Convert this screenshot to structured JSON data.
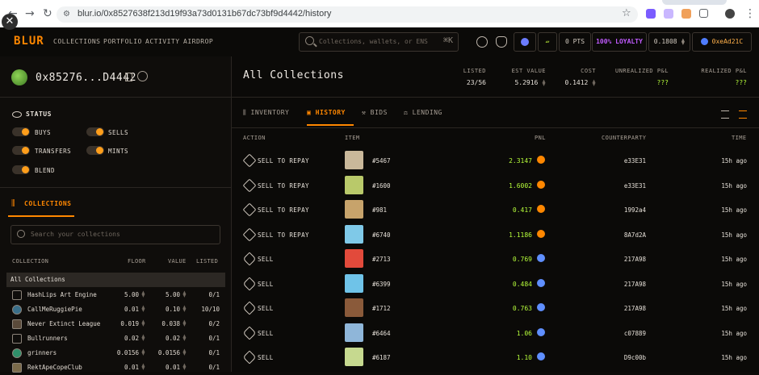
{
  "browser": {
    "url": "blur.io/0x8527638f213d19f93a73d0131b67dc73bf9d4442/history"
  },
  "app": {
    "logo": "BLUR",
    "nav": [
      "COLLECTIONS",
      "PORTFOLIO",
      "ACTIVITY",
      "AIRDROP"
    ],
    "search_placeholder": "Collections, wallets, or ENS",
    "search_shortcut": "⌘K",
    "points": "0 PTS",
    "loyalty": "100% LOYALTY",
    "balance": "0.1808",
    "account": "0xeAd21C",
    "colors": {
      "accent": "#ff8700",
      "positive": "#b8ff3b",
      "loyalty": "#b44bff"
    }
  },
  "sidebar": {
    "wallet": "0x85276...D4442",
    "status_title": "STATUS",
    "toggles": [
      {
        "label": "BUYS",
        "on": true
      },
      {
        "label": "SELLS",
        "on": true
      },
      {
        "label": "TRANSFERS",
        "on": true
      },
      {
        "label": "MINTS",
        "on": true
      },
      {
        "label": "BLEND",
        "on": true
      }
    ],
    "collections_tab": "COLLECTIONS",
    "collection_search_placeholder": "Search your collections",
    "headers": {
      "collection": "COLLECTION",
      "floor": "FLOOR",
      "value": "VALUE",
      "listed": "LISTED"
    },
    "all_label": "All Collections",
    "rows": [
      {
        "name": "HashLips Art Engine",
        "floor": "5.00",
        "value": "5.00",
        "listed": "0/1"
      },
      {
        "name": "CallMeRuggiePie",
        "floor": "0.01",
        "value": "0.10",
        "listed": "10/10"
      },
      {
        "name": "Never Extinct League",
        "floor": "0.019",
        "value": "0.038",
        "listed": "0/2"
      },
      {
        "name": "Bullrunners",
        "floor": "0.02",
        "value": "0.02",
        "listed": "0/1"
      },
      {
        "name": "grinners",
        "floor": "0.0156",
        "value": "0.0156",
        "listed": "0/1"
      },
      {
        "name": "RektApeCopeClub",
        "floor": "0.01",
        "value": "0.01",
        "listed": "0/1"
      }
    ]
  },
  "main": {
    "title": "All Collections",
    "stats": [
      {
        "label": "LISTED",
        "value": "23/56"
      },
      {
        "label": "EST VALUE",
        "value": "5.2916"
      },
      {
        "label": "COST",
        "value": "0.1412"
      },
      {
        "label": "UNREALIZED P&L",
        "value": "???"
      },
      {
        "label": "REALIZED P&L",
        "value": "???"
      }
    ],
    "tabs": [
      "INVENTORY",
      "HISTORY",
      "BIDS",
      "LENDING"
    ],
    "active_tab": "HISTORY",
    "columns": {
      "action": "ACTION",
      "item": "ITEM",
      "pnl": "PNL",
      "counterparty": "COUNTERPARTY",
      "time": "TIME"
    },
    "history": [
      {
        "action": "SELL TO REPAY",
        "item": "#5467",
        "pnl": "2.3147",
        "counterparty": "e33E31",
        "time": "15h ago",
        "icon": "repay-icon"
      },
      {
        "action": "SELL TO REPAY",
        "item": "#1600",
        "pnl": "1.6002",
        "counterparty": "e33E31",
        "time": "15h ago",
        "icon": "repay-icon"
      },
      {
        "action": "SELL TO REPAY",
        "item": "#981",
        "pnl": "0.417",
        "counterparty": "1992a4",
        "time": "15h ago",
        "icon": "repay-icon"
      },
      {
        "action": "SELL TO REPAY",
        "item": "#6740",
        "pnl": "1.1186",
        "counterparty": "8A7d2A",
        "time": "15h ago",
        "icon": "repay-icon"
      },
      {
        "action": "SELL",
        "item": "#2713",
        "pnl": "0.769",
        "counterparty": "217A98",
        "time": "15h ago",
        "icon": "tag-icon"
      },
      {
        "action": "SELL",
        "item": "#6399",
        "pnl": "0.484",
        "counterparty": "217A98",
        "time": "15h ago",
        "icon": "tag-icon"
      },
      {
        "action": "SELL",
        "item": "#1712",
        "pnl": "0.763",
        "counterparty": "217A98",
        "time": "15h ago",
        "icon": "tag-icon"
      },
      {
        "action": "SELL",
        "item": "#6464",
        "pnl": "1.06",
        "counterparty": "c07889",
        "time": "15h ago",
        "icon": "tag-icon"
      },
      {
        "action": "SELL",
        "item": "#6187",
        "pnl": "1.10",
        "counterparty": "D9c00b",
        "time": "15h ago",
        "icon": "tag-icon"
      }
    ]
  }
}
